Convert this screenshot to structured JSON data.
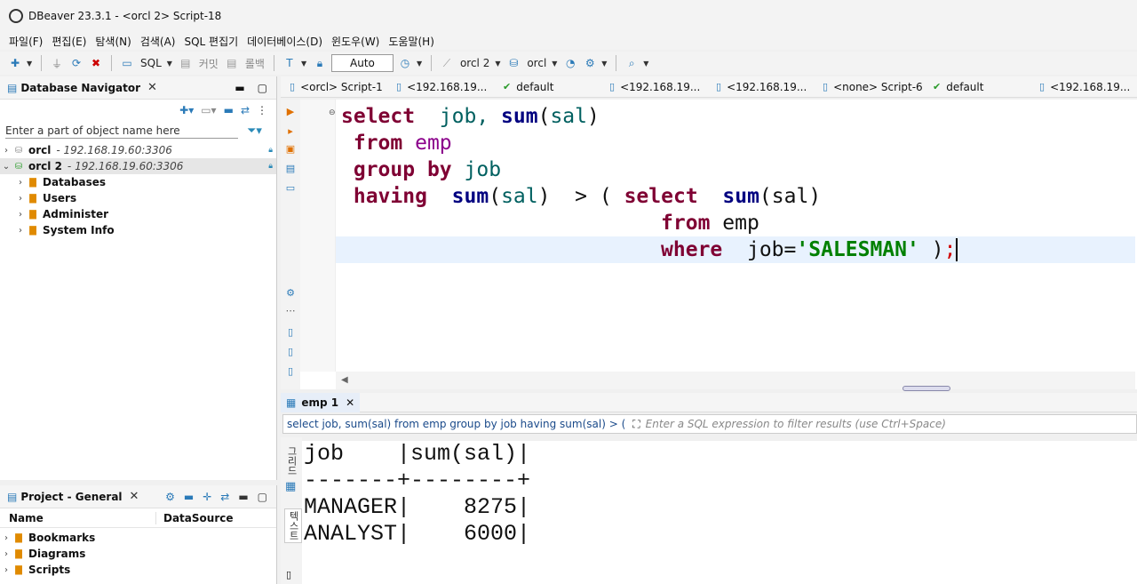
{
  "window": {
    "title": "DBeaver 23.3.1 - <orcl 2> Script-18"
  },
  "menu": [
    "파일(F)",
    "편집(E)",
    "탐색(N)",
    "검색(A)",
    "SQL 편집기",
    "데이터베이스(D)",
    "윈도우(W)",
    "도움말(H)"
  ],
  "toolbar": {
    "sql_label": "SQL",
    "commit_label": "커밋",
    "rollback_label": "롤백",
    "transaction_mode": "Auto",
    "connection": "orcl 2",
    "schema": "orcl"
  },
  "navigator": {
    "title": "Database Navigator",
    "filter_placeholder": "Enter a part of object name here",
    "connections": [
      {
        "name": "orcl",
        "host": "- 192.168.19.60:3306"
      },
      {
        "name": "orcl 2",
        "host": "- 192.168.19.60:3306"
      }
    ],
    "children": [
      "Databases",
      "Users",
      "Administer",
      "System Info"
    ]
  },
  "project": {
    "title": "Project - General",
    "col_name": "Name",
    "col_datasource": "DataSource",
    "items": [
      "Bookmarks",
      "Diagrams",
      "Scripts"
    ]
  },
  "editor_tabs": [
    "<orcl> Script-1",
    "<192.168.19...",
    "default",
    "<192.168.19...",
    "<192.168.19...",
    "<none> Script-6",
    "default",
    "<192.168.19..."
  ],
  "results": {
    "tab_label": "emp 1",
    "query_text": "select job, sum(sal) from emp group by job having sum(sal) > (",
    "filter_placeholder": "Enter a SQL expression to filter results (use Ctrl+Space)",
    "side_grid_label": "그리드",
    "side_text_label": "텍스트",
    "lines": [
      "job    |sum(sal)|",
      "-------+--------+",
      "MANAGER|    8275|",
      "ANALYST|    6000|"
    ]
  },
  "code": {
    "l1": [
      "select",
      "job,",
      "sum",
      "(",
      "sal",
      ")"
    ],
    "l2": [
      "from",
      "emp"
    ],
    "l3": [
      "group by",
      "job"
    ],
    "l4": [
      "having",
      "sum",
      "(",
      "sal",
      ")",
      "> (",
      "select",
      "sum",
      "(",
      "sal",
      ")"
    ],
    "l5": [
      "from",
      "emp"
    ],
    "l6": [
      "where",
      "job=",
      "'SALESMAN'",
      " )",
      ";"
    ]
  }
}
